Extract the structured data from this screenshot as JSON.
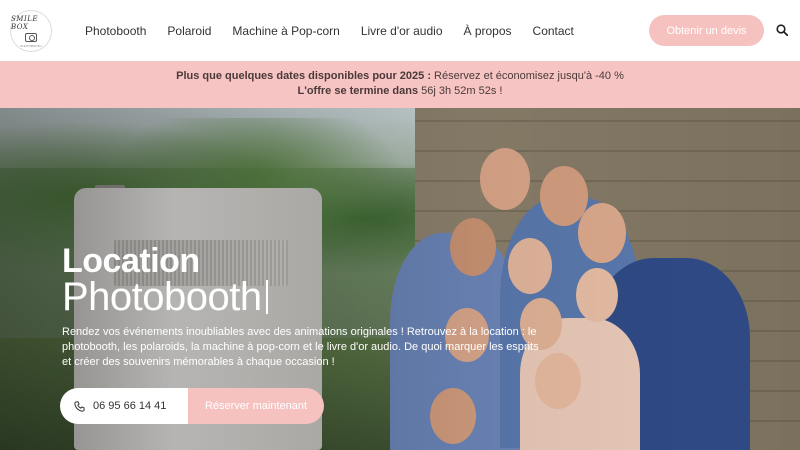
{
  "header": {
    "logo": {
      "text": "SMILE BOX",
      "sub": "PHOTOBOOTH"
    },
    "nav": [
      "Photobooth",
      "Polaroid",
      "Machine à Pop-corn",
      "Livre d'or audio",
      "À propos",
      "Contact"
    ],
    "cta_label": "Obtenir un devis",
    "search_icon": "search-icon"
  },
  "promo": {
    "line1_bold": "Plus que quelques dates disponibles pour 2025 :",
    "line1_rest": " Réservez et économisez jusqu'à -40 %",
    "line2_bold": "L'offre se termine dans",
    "line2_rest": " 56j 3h 52m 52s !"
  },
  "hero": {
    "title_line1": "Location",
    "title_line2": "Photobooth",
    "description": "Rendez vos événements inoubliables avec des animations originales ! Retrouvez à la location : le photobooth, les polaroids, la machine à pop-corn et le livre d'or audio. De quoi marquer les esprits et créer des souvenirs mémorables à chaque occasion !",
    "phone": "06 95 66 14 41",
    "book_label": "Réserver maintenant"
  },
  "colors": {
    "accent": "#f6c2c0",
    "promo_bg": "#f6c4c2"
  }
}
